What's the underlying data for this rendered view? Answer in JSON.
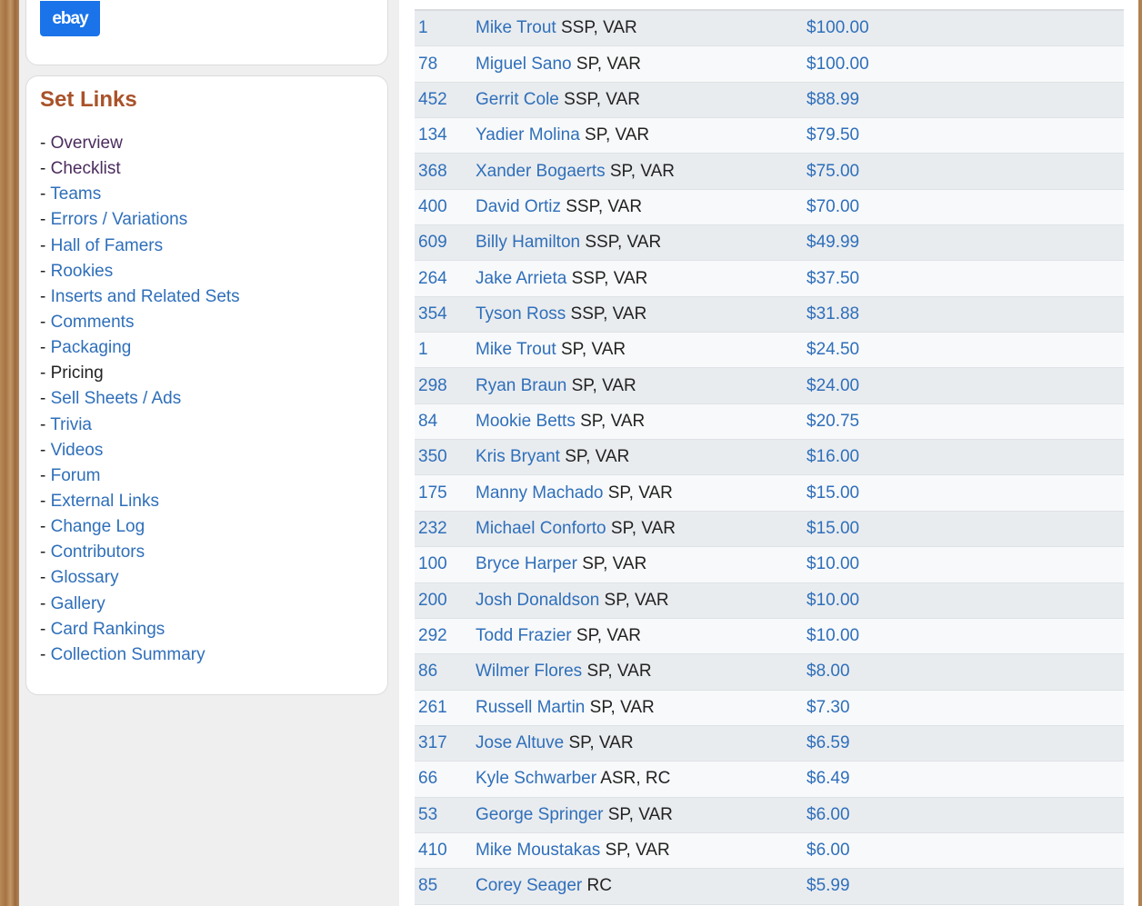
{
  "ebay_button": {
    "label": "ebay"
  },
  "set_links": {
    "title": "Set Links",
    "items": [
      {
        "label": "Overview",
        "state": "visited"
      },
      {
        "label": "Checklist",
        "state": "visited"
      },
      {
        "label": "Teams",
        "state": "link"
      },
      {
        "label": "Errors / Variations",
        "state": "link"
      },
      {
        "label": "Hall of Famers",
        "state": "link"
      },
      {
        "label": "Rookies",
        "state": "link"
      },
      {
        "label": "Inserts and Related Sets",
        "state": "link"
      },
      {
        "label": "Comments",
        "state": "link"
      },
      {
        "label": "Packaging",
        "state": "link"
      },
      {
        "label": "Pricing",
        "state": "current"
      },
      {
        "label": "Sell Sheets / Ads",
        "state": "link"
      },
      {
        "label": "Trivia",
        "state": "link"
      },
      {
        "label": "Videos",
        "state": "link"
      },
      {
        "label": "Forum",
        "state": "link"
      },
      {
        "label": "External Links",
        "state": "link"
      },
      {
        "label": "Change Log",
        "state": "link"
      },
      {
        "label": "Contributors",
        "state": "link"
      },
      {
        "label": "Glossary",
        "state": "link"
      },
      {
        "label": "Gallery",
        "state": "link"
      },
      {
        "label": "Card Rankings",
        "state": "link"
      },
      {
        "label": "Collection Summary",
        "state": "link"
      }
    ]
  },
  "pricing_table": {
    "rows": [
      {
        "num": "1",
        "player": "Mike Trout",
        "attr": "SSP, VAR",
        "price": "$100.00"
      },
      {
        "num": "78",
        "player": "Miguel Sano",
        "attr": "SP, VAR",
        "price": "$100.00"
      },
      {
        "num": "452",
        "player": "Gerrit Cole",
        "attr": "SSP, VAR",
        "price": "$88.99"
      },
      {
        "num": "134",
        "player": "Yadier Molina",
        "attr": "SP, VAR",
        "price": "$79.50"
      },
      {
        "num": "368",
        "player": "Xander Bogaerts",
        "attr": "SP, VAR",
        "price": "$75.00"
      },
      {
        "num": "400",
        "player": "David Ortiz",
        "attr": "SSP, VAR",
        "price": "$70.00"
      },
      {
        "num": "609",
        "player": "Billy Hamilton",
        "attr": "SSP, VAR",
        "price": "$49.99"
      },
      {
        "num": "264",
        "player": "Jake Arrieta",
        "attr": "SSP, VAR",
        "price": "$37.50"
      },
      {
        "num": "354",
        "player": "Tyson Ross",
        "attr": "SSP, VAR",
        "price": "$31.88"
      },
      {
        "num": "1",
        "player": "Mike Trout",
        "attr": "SP, VAR",
        "price": "$24.50"
      },
      {
        "num": "298",
        "player": "Ryan Braun",
        "attr": "SP, VAR",
        "price": "$24.00"
      },
      {
        "num": "84",
        "player": "Mookie Betts",
        "attr": "SP, VAR",
        "price": "$20.75"
      },
      {
        "num": "350",
        "player": "Kris Bryant",
        "attr": "SP, VAR",
        "price": "$16.00"
      },
      {
        "num": "175",
        "player": "Manny Machado",
        "attr": "SP, VAR",
        "price": "$15.00"
      },
      {
        "num": "232",
        "player": "Michael Conforto",
        "attr": "SP, VAR",
        "price": "$15.00"
      },
      {
        "num": "100",
        "player": "Bryce Harper",
        "attr": "SP, VAR",
        "price": "$10.00"
      },
      {
        "num": "200",
        "player": "Josh Donaldson",
        "attr": "SP, VAR",
        "price": "$10.00"
      },
      {
        "num": "292",
        "player": "Todd Frazier",
        "attr": "SP, VAR",
        "price": "$10.00"
      },
      {
        "num": "86",
        "player": "Wilmer Flores",
        "attr": "SP, VAR",
        "price": "$8.00"
      },
      {
        "num": "261",
        "player": "Russell Martin",
        "attr": "SP, VAR",
        "price": "$7.30"
      },
      {
        "num": "317",
        "player": "Jose Altuve",
        "attr": "SP, VAR",
        "price": "$6.59"
      },
      {
        "num": "66",
        "player": "Kyle Schwarber",
        "attr": "ASR, RC",
        "price": "$6.49"
      },
      {
        "num": "53",
        "player": "George Springer",
        "attr": "SP, VAR",
        "price": "$6.00"
      },
      {
        "num": "410",
        "player": "Mike Moustakas",
        "attr": "SP, VAR",
        "price": "$6.00"
      },
      {
        "num": "85",
        "player": "Corey Seager",
        "attr": "RC",
        "price": "$5.99"
      }
    ]
  }
}
